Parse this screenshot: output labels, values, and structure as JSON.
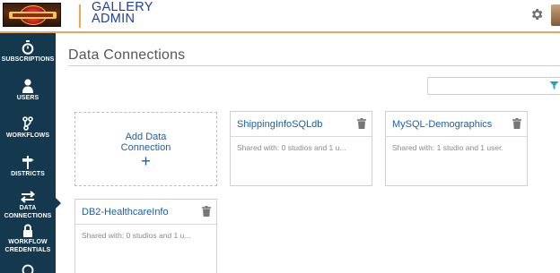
{
  "header": {
    "title_line1": "GALLERY",
    "title_line2": "ADMIN"
  },
  "sidebar": {
    "items": [
      {
        "label": "SUBSCRIPTIONS",
        "icon": "stopwatch-icon"
      },
      {
        "label": "USERS",
        "icon": "user-icon"
      },
      {
        "label": "WORKFLOWS",
        "icon": "workflow-branch-icon"
      },
      {
        "label": "DISTRICTS",
        "icon": "signpost-icon"
      },
      {
        "label_line1": "DATA",
        "label_line2": "CONNECTIONS",
        "icon": "arrows-exchange-icon",
        "active": true
      },
      {
        "label_line1": "WORKFLOW",
        "label_line2": "CREDENTIALS",
        "icon": "lock-icon"
      }
    ]
  },
  "main": {
    "page_title": "Data Connections",
    "search": {
      "value": "",
      "placeholder": ""
    },
    "add_tile": {
      "label_line1": "Add Data",
      "label_line2": "Connection",
      "plus": "+"
    },
    "connections": [
      {
        "name": "ShippingInfoSQLdb",
        "shared": "Shared with: 0 studios and 1 u..."
      },
      {
        "name": "MySQL-Demographics",
        "shared": "Shared with: 1 studio and 1 user."
      },
      {
        "name": "DB2-HealthcareInfo",
        "shared": "Shared with: 0 studios and 1 u..."
      }
    ]
  },
  "colors": {
    "accent": "#f0a35a",
    "sidebar": "#14394f",
    "link": "#1a5fa8",
    "title": "#1e3f9e",
    "filter": "#1fa3c4"
  }
}
